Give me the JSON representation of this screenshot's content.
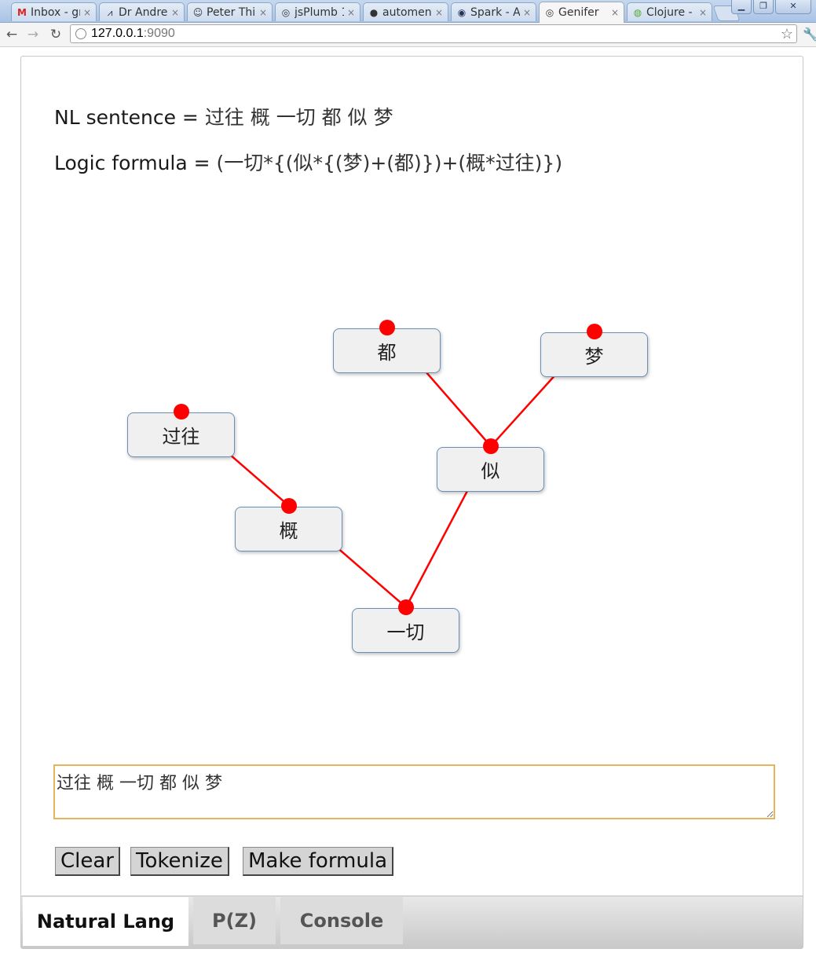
{
  "browser": {
    "tabs": [
      {
        "title": "Inbox - gr",
        "icon": "gmail-icon"
      },
      {
        "title": "Dr Andre",
        "icon": "chart-icon"
      },
      {
        "title": "Peter Thi",
        "icon": "person-icon"
      },
      {
        "title": "jsPlumb 1",
        "icon": "globe-icon"
      },
      {
        "title": "automen",
        "icon": "github-icon"
      },
      {
        "title": "Spark - A",
        "icon": "spark-icon"
      },
      {
        "title": "Genifer",
        "icon": "globe-icon",
        "active": true
      },
      {
        "title": "Clojure -",
        "icon": "clojure-icon"
      }
    ],
    "address": {
      "host": "127.0.0.1",
      "port": ":9090"
    }
  },
  "page": {
    "nl_label": "NL sentence = ",
    "nl_value": "过往 概 一切 都 似 梦",
    "logic_label": "Logic formula = ",
    "logic_value": "(一切*{(似*{(梦)+(都)})+(概*过往)})",
    "graph": {
      "nodes": [
        {
          "id": "n-dou",
          "label": "都"
        },
        {
          "id": "n-meng",
          "label": "梦"
        },
        {
          "id": "n-guowang",
          "label": "过往"
        },
        {
          "id": "n-si",
          "label": "似"
        },
        {
          "id": "n-gai",
          "label": "概"
        },
        {
          "id": "n-yiqie",
          "label": "一切"
        }
      ],
      "edges": [
        [
          "n-dou",
          "n-si"
        ],
        [
          "n-meng",
          "n-si"
        ],
        [
          "n-si",
          "n-yiqie"
        ],
        [
          "n-guowang",
          "n-gai"
        ],
        [
          "n-gai",
          "n-yiqie"
        ]
      ],
      "link_color": "#ff0000"
    },
    "input_value": "过往 概 一切 都 似 梦",
    "buttons": {
      "clear": "Clear",
      "tokenize": "Tokenize",
      "make_formula": "Make formula"
    },
    "tabs": [
      {
        "label": "Natural Lang",
        "active": true
      },
      {
        "label": "P(Z)"
      },
      {
        "label": "Console"
      }
    ]
  }
}
